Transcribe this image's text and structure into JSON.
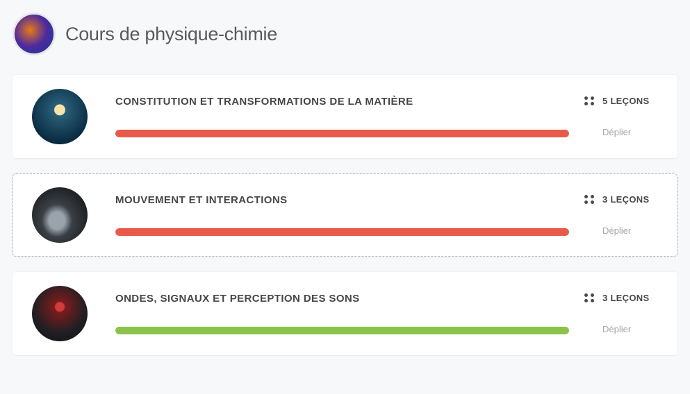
{
  "header": {
    "title": "Cours de physique-chimie"
  },
  "cards": [
    {
      "title": "CONSTITUTION ET TRANSFORMATIONS DE LA MATIÈRE",
      "lessons": "5 LEÇONS",
      "expand": "Déplier",
      "progress_color": "red",
      "progress_pct": 100,
      "avatar_class": "av1",
      "hover": false
    },
    {
      "title": "MOUVEMENT ET INTERACTIONS",
      "lessons": "3 LEÇONS",
      "expand": "Déplier",
      "progress_color": "red",
      "progress_pct": 100,
      "avatar_class": "av2",
      "hover": true
    },
    {
      "title": "ONDES, SIGNAUX ET PERCEPTION DES SONS",
      "lessons": "3 LEÇONS",
      "expand": "Déplier",
      "progress_color": "green",
      "progress_pct": 100,
      "avatar_class": "av3",
      "hover": false
    }
  ]
}
